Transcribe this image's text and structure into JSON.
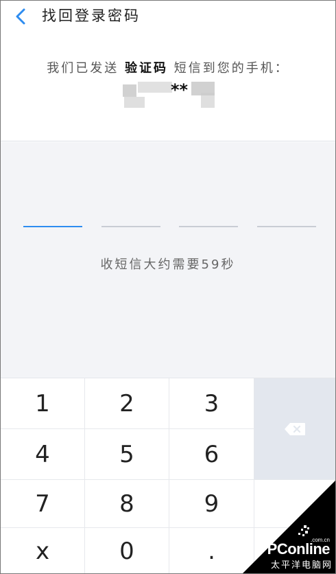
{
  "header": {
    "back_icon": "chevron-left-icon",
    "title": "找回登录密码",
    "sent_prefix": "我们已发送",
    "sent_bold": "验证码",
    "sent_suffix": "短信到您的手机：",
    "phone_masked": "**"
  },
  "code_entry": {
    "slots": 4,
    "active_slot": 0,
    "hint": "收短信大约需要59秒"
  },
  "keypad": {
    "keys": [
      "1",
      "2",
      "3",
      "4",
      "5",
      "6",
      "7",
      "8",
      "9",
      "x",
      "0",
      "."
    ],
    "delete_icon": "backspace-icon"
  },
  "colors": {
    "accent": "#2d8cf0",
    "background": "#f3f4f7",
    "delete_key": "#e3e7ee"
  },
  "watermark": {
    "brand": "PConline",
    "domain": ".com.cn",
    "tagline": "太平洋电脑网"
  }
}
